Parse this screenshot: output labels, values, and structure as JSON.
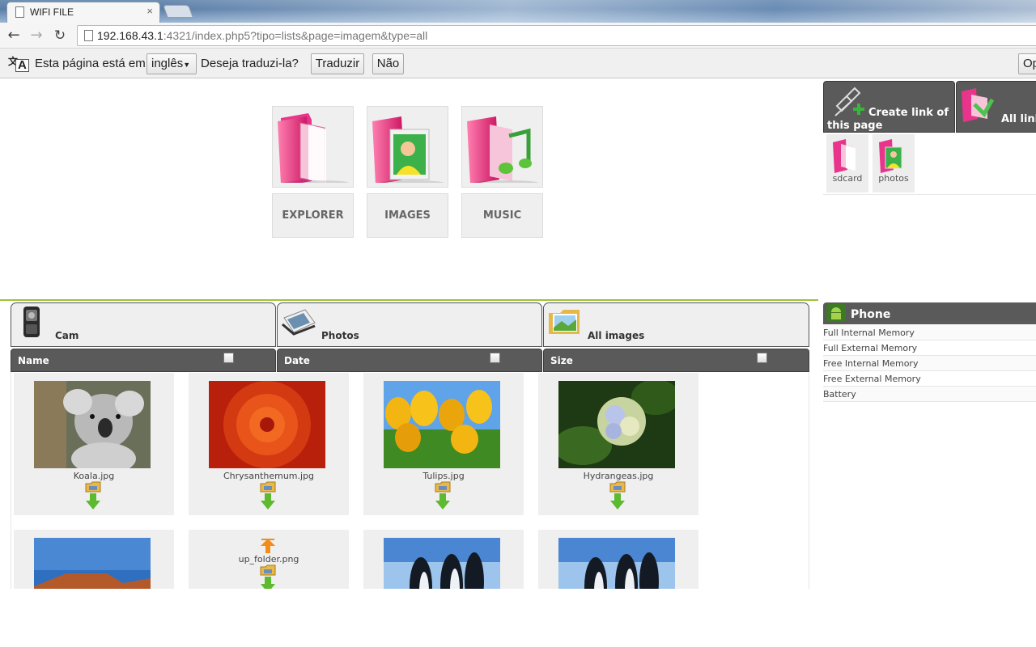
{
  "browser": {
    "tab_title": "WIFI FILE",
    "tab_close": "×",
    "url_host": "192.168.43.1",
    "url_rest": ":4321/index.php5?tipo=lists&page=imagem&type=all"
  },
  "translate_bar": {
    "prefix": "Esta página está em",
    "language": "inglês",
    "question": "Deseja traduzi-la?",
    "translate_label": "Traduzir",
    "no_label": "Não",
    "options_label": "Op"
  },
  "nav": {
    "explorer": "EXPLORER",
    "images": "IMAGES",
    "music": "MUSIC"
  },
  "links": {
    "create_line1": "Create link of",
    "create_line2": "this page",
    "all_links": "All link",
    "shortcuts": [
      "sdcard",
      "photos"
    ]
  },
  "categories": {
    "cam": "Cam",
    "photos": "Photos",
    "all_images": "All images"
  },
  "sort": {
    "name": "Name",
    "date": "Date",
    "size": "Size"
  },
  "files": [
    {
      "name": "Koala.jpg",
      "thumb": "koala"
    },
    {
      "name": "Chrysanthemum.jpg",
      "thumb": "chrysanthemum"
    },
    {
      "name": "Tulips.jpg",
      "thumb": "tulips"
    },
    {
      "name": "Hydrangeas.jpg",
      "thumb": "hydrangeas"
    },
    {
      "name": "",
      "thumb": "desert"
    },
    {
      "name": "up_folder.png",
      "thumb": "up-folder"
    },
    {
      "name": "",
      "thumb": "penguins"
    },
    {
      "name": "",
      "thumb": "penguins"
    }
  ],
  "phone": {
    "title": "Phone",
    "rows": [
      "Full Internal Memory",
      "Full External Memory",
      "Free Internal Memory",
      "Free External Memory",
      "Battery"
    ]
  },
  "colors": {
    "accent_green": "#9bc43a",
    "dark_header": "#5a5a5a",
    "folder_pink": "#d8246a",
    "tile_bg": "#efefef"
  }
}
